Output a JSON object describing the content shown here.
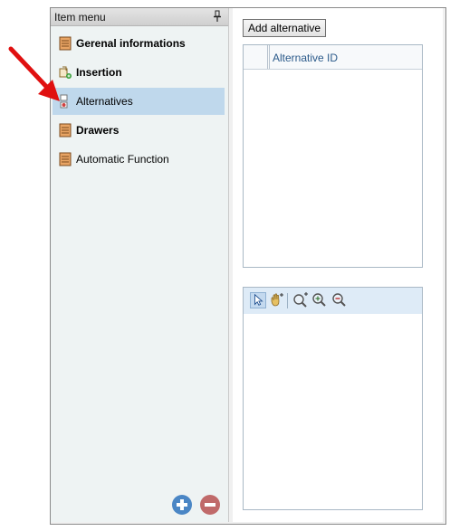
{
  "left_panel": {
    "title": "Item menu",
    "items": [
      {
        "label": "Gerenal informations",
        "bold": true
      },
      {
        "label": "Insertion",
        "bold": true
      },
      {
        "label": "Alternatives",
        "bold": false,
        "selected": true
      },
      {
        "label": "Drawers",
        "bold": true
      },
      {
        "label": "Automatic Function",
        "bold": false
      }
    ],
    "icons": [
      "pin-icon",
      "orange-item-icon",
      "insertion-icon",
      "alternatives-icon",
      "orange-item-icon",
      "orange-item-icon",
      "add-icon",
      "remove-icon"
    ]
  },
  "right_panel": {
    "add_alternative_label": "Add alternative",
    "grid": {
      "columns": [
        "Alternative ID"
      ],
      "rows": []
    },
    "viewer_toolbar": [
      "select-pointer-icon",
      "pan-hand-icon",
      "zoom-in-icon",
      "zoom-icon",
      "zoom-out-icon"
    ]
  },
  "colors": {
    "selection": "#bfd8ec",
    "add": "#4a86c5",
    "remove": "#c06a6a",
    "annotation_arrow": "#e01010"
  }
}
